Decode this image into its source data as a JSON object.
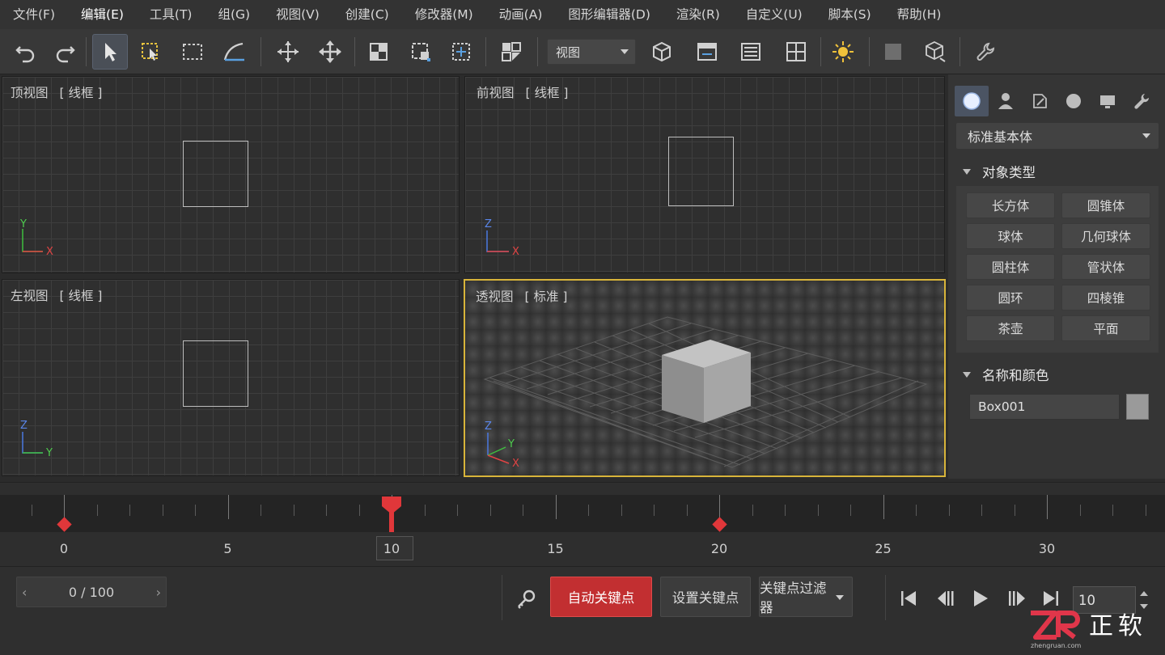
{
  "menu": [
    "文件(F)",
    "编辑(E)",
    "工具(T)",
    "组(G)",
    "视图(V)",
    "创建(C)",
    "修改器(M)",
    "动画(A)",
    "图形编辑器(D)",
    "渲染(R)",
    "自定义(U)",
    "脚本(S)",
    "帮助(H)"
  ],
  "toolbar": {
    "view_select": "视图",
    "icons": [
      "undo-icon",
      "redo-icon",
      "select-icon",
      "select-region-icon",
      "rectangle-select-icon",
      "arc-snap-icon",
      "move-icon",
      "move-all-icon",
      "mirror-icon",
      "align-icon",
      "layer-icon",
      "scene-explorer-icon",
      "view-select",
      "cube-icon",
      "curve-editor-icon",
      "ribbon-icon",
      "grid-icon",
      "sun-icon",
      "material-icon",
      "render-box-icon",
      "wrench-icon"
    ]
  },
  "viewports": {
    "top": {
      "name": "顶视图",
      "mode": "[ 线框 ]",
      "axis_v": "Y",
      "axis_h": "X"
    },
    "front": {
      "name": "前视图",
      "mode": "[ 线框 ]",
      "axis_v": "Z",
      "axis_h": "X"
    },
    "left": {
      "name": "左视图",
      "mode": "[ 线框 ]",
      "axis_v": "Z",
      "axis_h": "Y"
    },
    "perspective": {
      "name": "透视图",
      "mode": "[ 标准 ]",
      "axis_z": "Z",
      "axis_y": "Y",
      "axis_x": "X"
    }
  },
  "panel": {
    "tabs": [
      "create-icon",
      "modify-icon",
      "hierarchy-icon",
      "motion-icon",
      "display-icon",
      "utilities-icon"
    ],
    "category": "标准基本体",
    "object_type_title": "对象类型",
    "objects": [
      "长方体",
      "圆锥体",
      "球体",
      "几何球体",
      "圆柱体",
      "管状体",
      "圆环",
      "四棱锥",
      "茶壶",
      "平面"
    ],
    "name_color_title": "名称和颜色",
    "object_name": "Box001",
    "swatch_color": "#9a9a9a"
  },
  "timeline": {
    "labels": [
      {
        "frame": 0,
        "text": "0"
      },
      {
        "frame": 5,
        "text": "5"
      },
      {
        "frame": 10,
        "text": "10"
      },
      {
        "frame": 15,
        "text": "15"
      },
      {
        "frame": 20,
        "text": "20"
      },
      {
        "frame": 25,
        "text": "25"
      },
      {
        "frame": 30,
        "text": "30"
      }
    ],
    "current_frame": 10,
    "keyframes": [
      0,
      20
    ]
  },
  "bottom": {
    "frame_range": "0 / 100",
    "lt": "‹",
    "gt": "›",
    "auto_key": "自动关键点",
    "set_key": "设置关键点",
    "key_filter": "关键点过滤器",
    "frame_value": "10"
  },
  "watermark": {
    "brand": "正软",
    "sub": "zhengruan.com"
  },
  "colors": {
    "accent_active": "#d8b43a",
    "auto_key": "#c22f31",
    "keyframe": "#e0373a"
  }
}
